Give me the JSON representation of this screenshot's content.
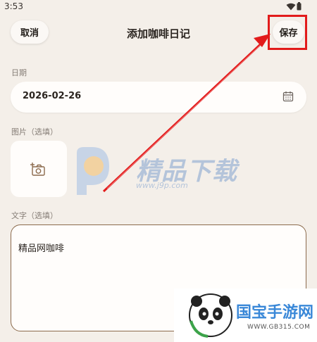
{
  "status_bar": {
    "time": "3:53"
  },
  "header": {
    "title": "添加咖啡日记",
    "cancel_label": "取消",
    "save_label": "保存"
  },
  "date_section": {
    "label": "日期",
    "value": "2026-02-26"
  },
  "image_section": {
    "label": "图片（选填）"
  },
  "text_section": {
    "label": "文字（选填）",
    "value": "精品网咖啡"
  },
  "watermarks": {
    "center_text": "精品下载",
    "center_url": "www.j9p.com",
    "corner_text": "国宝手游网",
    "corner_url": "WWW.GB315.COM"
  },
  "colors": {
    "highlight": "#e21b1b",
    "background": "#f4efe9",
    "text_area_border": "#8b6a4c"
  }
}
